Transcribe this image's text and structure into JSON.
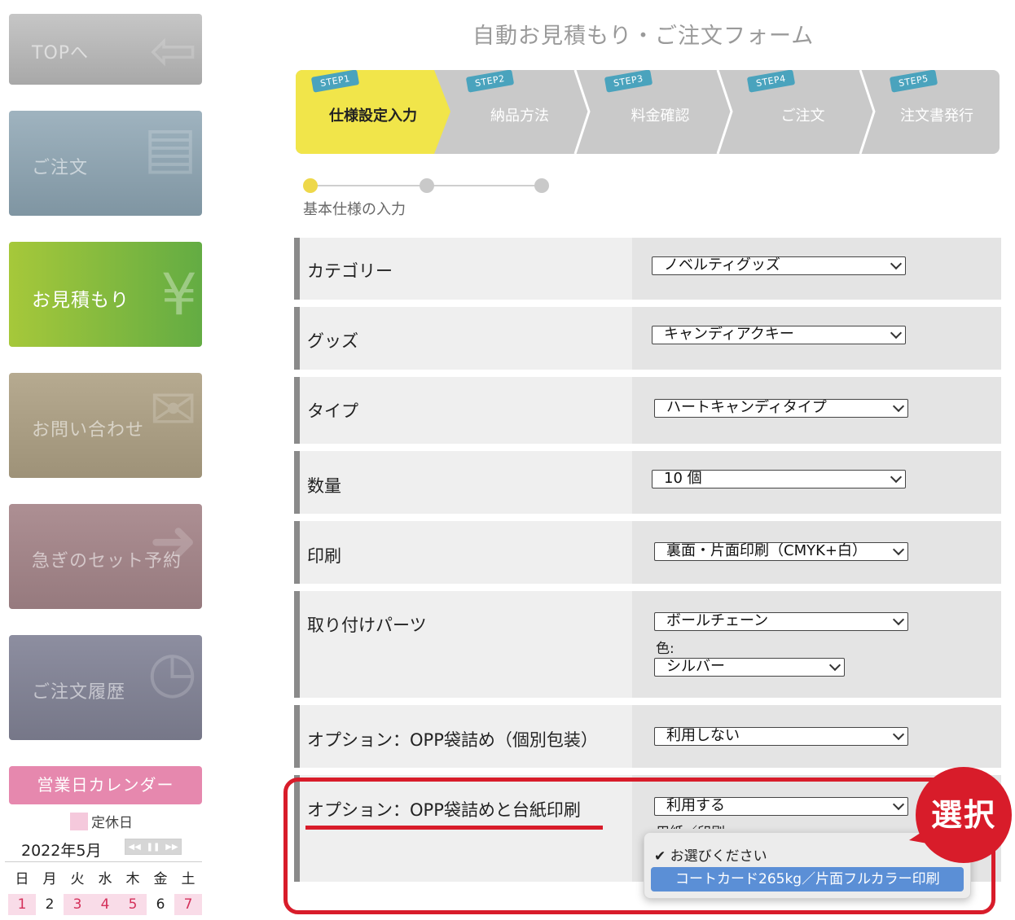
{
  "sidebar": {
    "top": "TOPへ",
    "order": "ご注文",
    "estimate": "お見積もり",
    "contact": "お問い合わせ",
    "set_reservation": "急ぎのセット予約",
    "history": "ご注文履歴"
  },
  "calendar": {
    "title": "営業日カレンダー",
    "legend": "定休日",
    "month": "2022年5月",
    "weekdays": [
      "日",
      "月",
      "火",
      "水",
      "木",
      "金",
      "土"
    ],
    "days": [
      "1",
      "2",
      "3",
      "4",
      "5",
      "6",
      "7"
    ],
    "holidays": [
      true,
      false,
      true,
      true,
      true,
      false,
      true
    ]
  },
  "page_title": "自動お見積もり・ご注文フォーム",
  "steps": [
    {
      "tag": "STEP1",
      "label": "仕様設定入力",
      "active": true
    },
    {
      "tag": "STEP2",
      "label": "納品方法",
      "active": false
    },
    {
      "tag": "STEP3",
      "label": "料金確認",
      "active": false
    },
    {
      "tag": "STEP4",
      "label": "ご注文",
      "active": false
    },
    {
      "tag": "STEP5",
      "label": "注文書発行",
      "active": false
    }
  ],
  "progress_label": "基本仕様の入力",
  "form": {
    "category": {
      "label": "カテゴリー",
      "value": "ノベルティグッズ"
    },
    "goods": {
      "label": "グッズ",
      "value": "キャンディアクキー"
    },
    "type": {
      "label": "タイプ",
      "value": "ハートキャンディタイプ"
    },
    "quantity": {
      "label": "数量",
      "value": "10 個"
    },
    "print": {
      "label": "印刷",
      "value": "裏面・片面印刷（CMYK+白）"
    },
    "parts": {
      "label": "取り付けパーツ",
      "value": "ボールチェーン",
      "color_label": "色:",
      "color_value": "シルバー"
    },
    "opp": {
      "label": "オプション：OPP袋詰め（個別包装）",
      "value": "利用しない"
    },
    "opp_print": {
      "label": "オプション：OPP袋詰めと台紙印刷",
      "value": "利用する",
      "paper_label": "用紙／印刷:"
    }
  },
  "dropdown": {
    "option1": "お選びください",
    "option2": "コートカード265kg／片面フルカラー印刷"
  },
  "badge": "選択"
}
